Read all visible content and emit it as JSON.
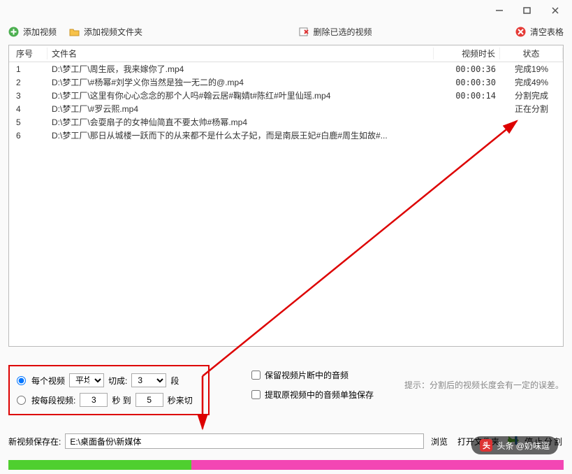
{
  "toolbar": {
    "add_video": "添加视频",
    "add_folder": "添加视频文件夹",
    "delete_selected": "删除已选的视频",
    "clear_table": "清空表格"
  },
  "table": {
    "headers": {
      "index": "序号",
      "filename": "文件名",
      "duration": "视频时长",
      "status": "状态"
    },
    "rows": [
      {
        "idx": "1",
        "name": "D:\\梦工厂\\周生辰，我来嫁你了.mp4",
        "dur": "00:00:36",
        "stat": "完成19%"
      },
      {
        "idx": "2",
        "name": "D:\\梦工厂\\#杨幂#刘学义你当然是独一无二的@.mp4",
        "dur": "00:00:30",
        "stat": "完成49%"
      },
      {
        "idx": "3",
        "name": "D:\\梦工厂\\这里有你心心念念的那个人吗#翰云居#鞠婧t#陈红#叶里仙瑶.mp4",
        "dur": "00:00:14",
        "stat": "分割完成"
      },
      {
        "idx": "4",
        "name": "D:\\梦工厂\\#罗云熙.mp4",
        "dur": "",
        "stat": "正在分割"
      },
      {
        "idx": "5",
        "name": "D:\\梦工厂\\会耍扇子的女神仙简直不要太帅#杨幂.mp4",
        "dur": "",
        "stat": ""
      },
      {
        "idx": "6",
        "name": "D:\\梦工厂\\那日从城楼一跃而下的从来都不是什么太子妃，而是南辰王妃#白鹿#周生如故#...",
        "dur": "",
        "stat": ""
      }
    ]
  },
  "options": {
    "each_video_label": "每个视频",
    "avg_select": "平均",
    "cut_into": "切成:",
    "segments_value": "3",
    "segment_suffix": "段",
    "by_segment_label": "按每段视频:",
    "seconds_from": "3",
    "sec_to": "秒 到",
    "seconds_to": "5",
    "sec_cut": "秒来切",
    "keep_audio": "保留视频片断中的音频",
    "extract_audio": "提取原视频中的音频单独保存",
    "hint": "提示：分割后的视频长度会有一定的误差。"
  },
  "save": {
    "label": "新视频保存在:",
    "path": "E:\\桌面备份\\新媒体",
    "browse": "浏览",
    "open": "打开文件夹",
    "stop": "停止分割"
  },
  "watermark": "头条 @奶味逗"
}
